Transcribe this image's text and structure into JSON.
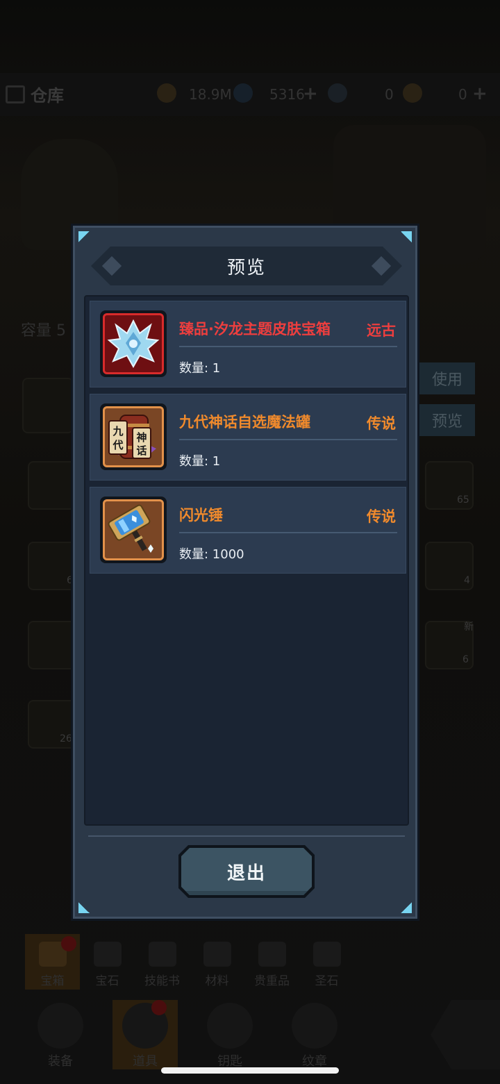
{
  "background": {
    "warehouse_label": "仓库",
    "resources": [
      {
        "icon": "coin-icon",
        "value": "18.9M"
      },
      {
        "icon": "crystal-icon",
        "value": "5316"
      },
      {
        "icon": "scroll-icon",
        "value": "0"
      },
      {
        "icon": "token-icon",
        "value": "0"
      }
    ],
    "capacity_label": "容量 5",
    "use_button": "使用",
    "preview_button": "预览",
    "slot_counts": [
      "65",
      "6",
      "4",
      "6",
      "26"
    ],
    "new_badge": "新",
    "category_tabs": [
      "宝箱",
      "宝石",
      "技能书",
      "材料",
      "贵重品",
      "圣石"
    ],
    "nav_items": [
      "装备",
      "道具",
      "钥匙",
      "纹章"
    ]
  },
  "modal": {
    "title": "预览",
    "items": [
      {
        "name": "臻品·汐龙主题皮肤宝箱",
        "rarity": "远古",
        "qty_label": "数量: 1",
        "icon": "dragon-skin-chest-icon",
        "color": "#ee3e3e"
      },
      {
        "name": "九代神话自选魔法罐",
        "rarity": "传说",
        "qty_label": "数量: 1",
        "icon": "magic-jar-icon",
        "color": "#f08a2c",
        "icon_text_1": "九",
        "icon_text_2": "代",
        "icon_text_3": "神",
        "icon_text_4": "话"
      },
      {
        "name": "闪光锤",
        "rarity": "传说",
        "qty_label": "数量: 1000",
        "icon": "flash-hammer-icon",
        "color": "#f08a2c"
      }
    ],
    "exit_button": "退出"
  }
}
